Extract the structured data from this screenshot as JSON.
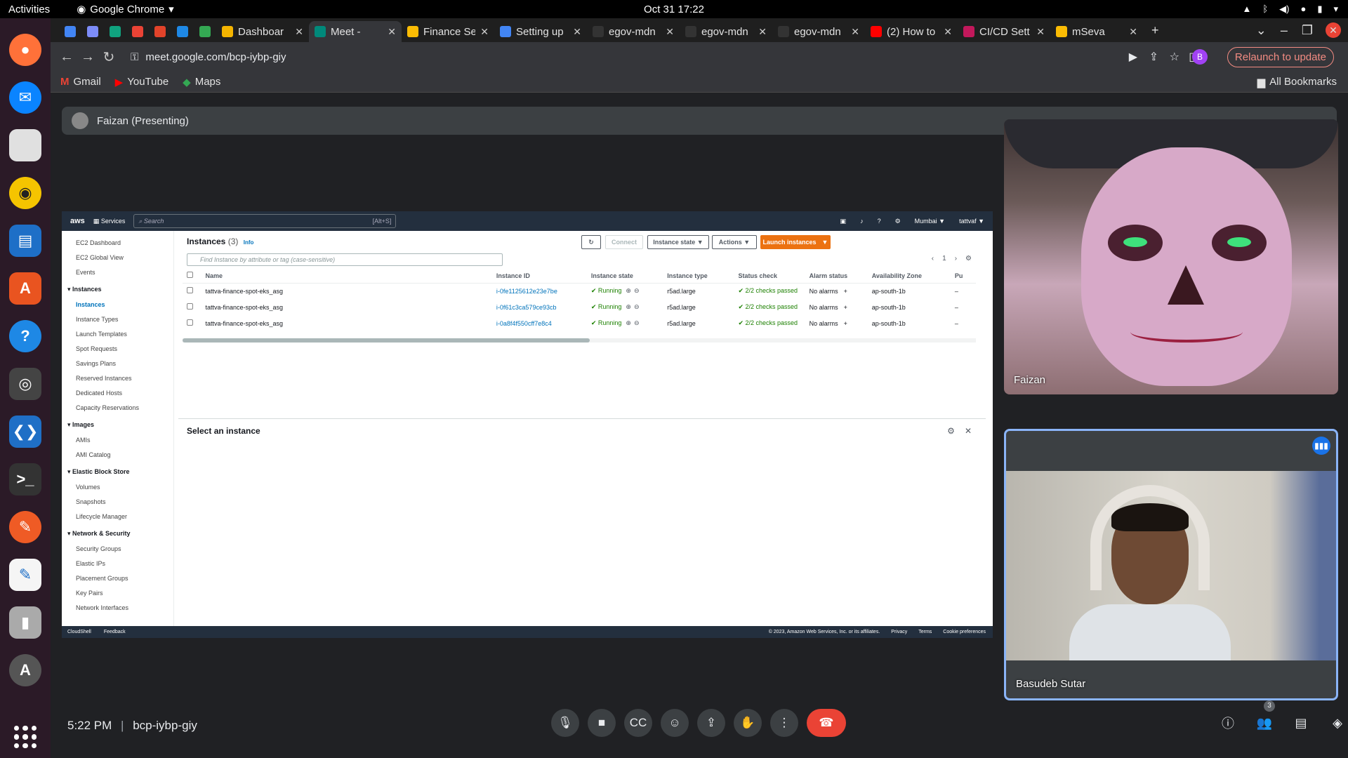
{
  "os": {
    "activities": "Activities",
    "app_name": "Google Chrome",
    "clock": "Oct 31  17:22"
  },
  "dock": {
    "apps": [
      "firefox",
      "thunderbird",
      "files",
      "rhythmbox",
      "writer",
      "software",
      "help",
      "chrome",
      "vscode",
      "terminal",
      "postman",
      "text-editor",
      "archive",
      "app-updater"
    ]
  },
  "chrome": {
    "tabs": [
      {
        "title": "",
        "color": "#4285f4"
      },
      {
        "title": "",
        "color": "#7c8cf8"
      },
      {
        "title": "",
        "color": "#10a37f"
      },
      {
        "title": "",
        "color": "#ea4335"
      },
      {
        "title": "",
        "color": "#e2432a"
      },
      {
        "title": "",
        "color": "#1e88e5"
      },
      {
        "title": "",
        "color": "#34a853"
      },
      {
        "title": "Dashboar",
        "color": "#f4b400"
      },
      {
        "title": "Meet -",
        "color": "#00897b",
        "active": true
      },
      {
        "title": "Finance Se",
        "color": "#fbbc04"
      },
      {
        "title": "Setting up",
        "color": "#4285f4"
      },
      {
        "title": "egov-mdn",
        "color": "#333333"
      },
      {
        "title": "egov-mdn",
        "color": "#333333"
      },
      {
        "title": "egov-mdn",
        "color": "#333333"
      },
      {
        "title": "(2) How to",
        "color": "#ff0000"
      },
      {
        "title": "CI/CD Sett",
        "color": "#c2185b"
      },
      {
        "title": "mSeva",
        "color": "#fbbc04"
      }
    ],
    "url": "meet.google.com/bcp-iybp-giy",
    "profile_initial": "B",
    "relaunch_label": "Relaunch to update",
    "bookmarks": [
      "Gmail",
      "YouTube",
      "Maps"
    ],
    "all_bookmarks": "All Bookmarks"
  },
  "meet": {
    "presenter_label": "Faizan (Presenting)",
    "meeting_time": "5:22 PM",
    "meeting_code": "bcp-iybp-giy",
    "participants_count": "3",
    "tiles": [
      {
        "name": "Faizan"
      },
      {
        "name": "Basudeb Sutar",
        "speaking": true
      }
    ]
  },
  "aws": {
    "header": {
      "logo": "aws",
      "services": "Services",
      "search_placeholder": "Search",
      "search_shortcut": "[Alt+S]",
      "region": "Mumbai ▼",
      "account": "tattvaf ▼"
    },
    "sidebar": {
      "top": [
        "EC2 Dashboard",
        "EC2 Global View",
        "Events"
      ],
      "sections": [
        {
          "title": "Instances",
          "items": [
            "Instances",
            "Instance Types",
            "Launch Templates",
            "Spot Requests",
            "Savings Plans",
            "Reserved Instances",
            "Dedicated Hosts",
            "Capacity Reservations"
          ]
        },
        {
          "title": "Images",
          "items": [
            "AMIs",
            "AMI Catalog"
          ]
        },
        {
          "title": "Elastic Block Store",
          "items": [
            "Volumes",
            "Snapshots",
            "Lifecycle Manager"
          ]
        },
        {
          "title": "Network & Security",
          "items": [
            "Security Groups",
            "Elastic IPs",
            "Placement Groups",
            "Key Pairs",
            "Network Interfaces"
          ]
        }
      ]
    },
    "main": {
      "title": "Instances",
      "count": "(3)",
      "info": "Info",
      "buttons": {
        "connect": "Connect",
        "instance_state": "Instance state ▼",
        "actions": "Actions ▼",
        "launch": "Launch instances"
      },
      "filter_placeholder": "Find Instance by attribute or tag (case-sensitive)",
      "page": "1",
      "columns": [
        "Name",
        "Instance ID",
        "Instance state",
        "Instance type",
        "Status check",
        "Alarm status",
        "Availability Zone",
        "Pu"
      ],
      "rows": [
        {
          "name": "tattva-finance-spot-eks_asg",
          "id": "i-0fe1125612e23e7be",
          "state": "Running",
          "type": "r5ad.large",
          "status": "2/2 checks passed",
          "alarm": "No alarms",
          "az": "ap-south-1b",
          "pu": "–"
        },
        {
          "name": "tattva-finance-spot-eks_asg",
          "id": "i-0f61c3ca579ce93cb",
          "state": "Running",
          "type": "r5ad.large",
          "status": "2/2 checks passed",
          "alarm": "No alarms",
          "az": "ap-south-1b",
          "pu": "–"
        },
        {
          "name": "tattva-finance-spot-eks_asg",
          "id": "i-0a8f4f550cff7e8c4",
          "state": "Running",
          "type": "r5ad.large",
          "status": "2/2 checks passed",
          "alarm": "No alarms",
          "az": "ap-south-1b",
          "pu": "–"
        }
      ],
      "select_instance": "Select an instance"
    },
    "footer": {
      "cloudshell": "CloudShell",
      "feedback": "Feedback",
      "copyright": "© 2023, Amazon Web Services, Inc. or its affiliates.",
      "privacy": "Privacy",
      "terms": "Terms",
      "cookies": "Cookie preferences"
    }
  }
}
